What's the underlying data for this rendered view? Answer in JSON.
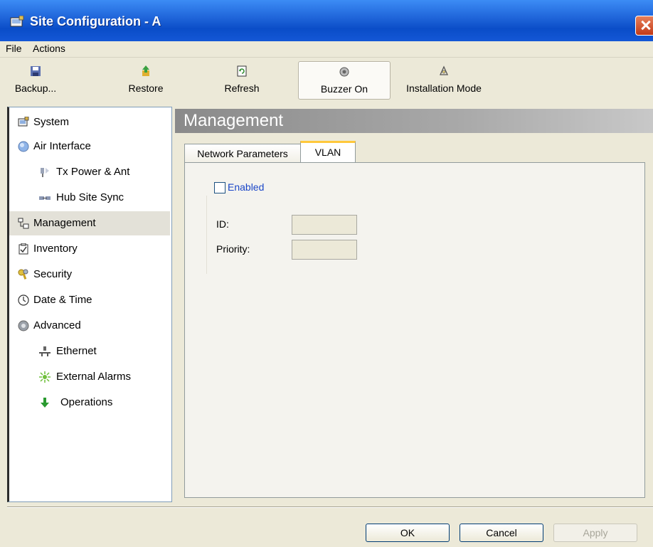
{
  "window": {
    "title": "Site Configuration - A"
  },
  "menu": {
    "items": [
      "File",
      "Actions"
    ]
  },
  "toolbar": {
    "backup": "Backup...",
    "restore": "Restore",
    "refresh": "Refresh",
    "buzzer": "Buzzer On",
    "installation": "Installation Mode"
  },
  "sidebar": {
    "items": [
      {
        "label": "System",
        "icon": "system-icon"
      },
      {
        "label": "Air Interface",
        "icon": "air-interface-icon"
      },
      {
        "label": "Tx Power & Ant",
        "icon": "antenna-icon"
      },
      {
        "label": "Hub Site Sync",
        "icon": "sync-icon"
      },
      {
        "label": "Management",
        "icon": "management-icon",
        "selected": true
      },
      {
        "label": "Inventory",
        "icon": "inventory-icon"
      },
      {
        "label": "Security",
        "icon": "key-icon"
      },
      {
        "label": "Date & Time",
        "icon": "clock-icon"
      },
      {
        "label": "Advanced",
        "icon": "gear-icon"
      },
      {
        "label": "Ethernet",
        "icon": "ethernet-icon"
      },
      {
        "label": "External Alarms",
        "icon": "alarm-icon"
      },
      {
        "label": "Operations",
        "icon": "arrow-down-icon"
      }
    ]
  },
  "content": {
    "title": "Management",
    "tabs": [
      "Network Parameters",
      "VLAN"
    ],
    "active_tab": "VLAN",
    "vlan": {
      "enabled_label": "Enabled",
      "enabled": false,
      "id_label": "ID:",
      "id_value": "",
      "priority_label": "Priority:",
      "priority_value": ""
    }
  },
  "footer": {
    "ok": "OK",
    "cancel": "Cancel",
    "apply": "Apply"
  },
  "colors": {
    "titlebar": "#1E63D8",
    "accent_tab": "#FFC83C",
    "link_text": "#1a46c8"
  }
}
